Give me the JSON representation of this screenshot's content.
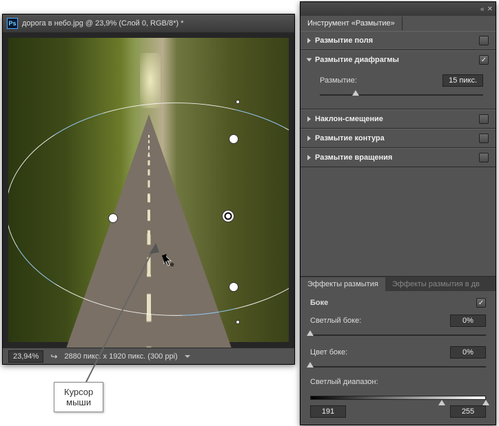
{
  "document": {
    "title": "дорога в небо.jpg @ 23,9% (Слой 0, RGB/8*) *",
    "zoom_field": "23,94%",
    "info": "2880 пикс. x 1920 пикс. (300 ppi)"
  },
  "panel": {
    "title": "Инструмент «Размытие»",
    "sections": {
      "field_blur": {
        "label": "Размытие поля",
        "checked": false
      },
      "iris_blur": {
        "label": "Размытие диафрагмы",
        "checked": true,
        "amount_label": "Размытие:",
        "amount_value": "15 пикс.",
        "slider_pct": 22
      },
      "tilt_shift": {
        "label": "Наклон-смещение",
        "checked": false
      },
      "path_blur": {
        "label": "Размытие контура",
        "checked": false
      },
      "spin_blur": {
        "label": "Размытие вращения",
        "checked": false
      }
    }
  },
  "effects": {
    "tab_active": "Эффекты размытия",
    "tab_inactive": "Эффекты размытия в дв",
    "bokeh_label": "Боке",
    "bokeh_checked": true,
    "light_bokeh": {
      "label": "Светлый боке:",
      "value": "0%",
      "slider_pct": 0
    },
    "color_bokeh": {
      "label": "Цвет боке:",
      "value": "0%",
      "slider_pct": 0
    },
    "light_range": {
      "label": "Светлый диапазон:",
      "low": "191",
      "high": "255",
      "low_pct": 75,
      "high_pct": 100
    }
  },
  "callout": {
    "line1": "Курсор",
    "line2": "мыши"
  }
}
